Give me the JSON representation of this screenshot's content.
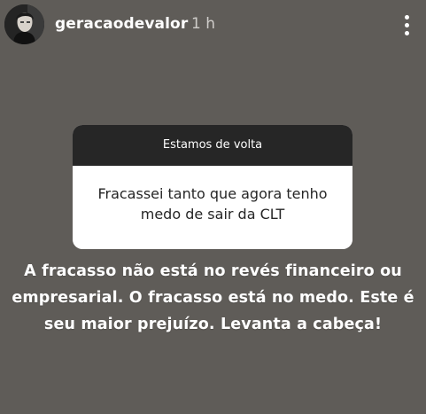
{
  "header": {
    "username": "geracaodevalor",
    "timestamp": "1 h",
    "more_icon": "more-vertical-icon"
  },
  "question_sticker": {
    "prompt": "Estamos de volta",
    "question": "Fracassei tanto que agora tenho medo de sair da CLT"
  },
  "answer": {
    "text": "A fracasso não está no revés financeiro ou empresarial. O fracasso está no medo. Este é seu maior prejuízo. Levanta a cabeça!"
  },
  "colors": {
    "background": "#5f5c58",
    "sticker_header": "#262626",
    "sticker_body": "#ffffff",
    "text_light": "#ffffff"
  }
}
